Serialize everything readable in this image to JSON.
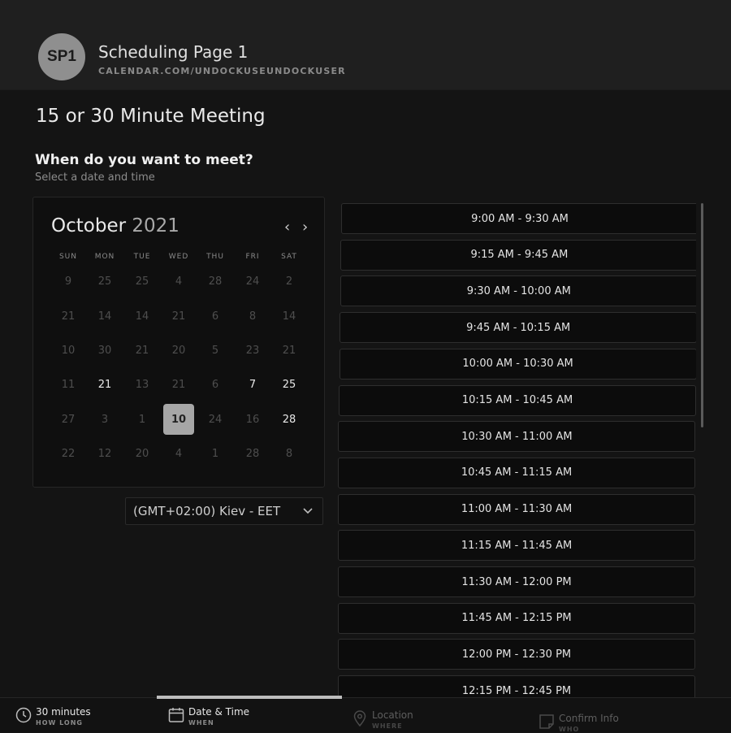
{
  "header": {
    "avatar_initials": "SP1",
    "title": "Scheduling Page 1",
    "url": "CALENDAR.COM/UNDOCKUSEUNDOCKUSER"
  },
  "meeting": {
    "title": "15 or 30 Minute Meeting",
    "question": "When do you want to meet?",
    "subtitle": "Select a date and time"
  },
  "calendar": {
    "month": "October",
    "year": "2021",
    "weekdays": [
      "SUN",
      "MON",
      "TUE",
      "WED",
      "THU",
      "FRI",
      "SAT"
    ],
    "weeks": [
      [
        {
          "d": "9"
        },
        {
          "d": "25"
        },
        {
          "d": "25"
        },
        {
          "d": "4"
        },
        {
          "d": "28"
        },
        {
          "d": "24"
        },
        {
          "d": "2"
        }
      ],
      [
        {
          "d": "21"
        },
        {
          "d": "14"
        },
        {
          "d": "14"
        },
        {
          "d": "21"
        },
        {
          "d": "6"
        },
        {
          "d": "8"
        },
        {
          "d": "14"
        }
      ],
      [
        {
          "d": "10"
        },
        {
          "d": "30"
        },
        {
          "d": "21"
        },
        {
          "d": "20"
        },
        {
          "d": "5"
        },
        {
          "d": "23"
        },
        {
          "d": "21"
        }
      ],
      [
        {
          "d": "11"
        },
        {
          "d": "21",
          "active": true
        },
        {
          "d": "13"
        },
        {
          "d": "21"
        },
        {
          "d": "6"
        },
        {
          "d": "7",
          "active": true
        },
        {
          "d": "25",
          "active": true
        }
      ],
      [
        {
          "d": "27"
        },
        {
          "d": "3"
        },
        {
          "d": "1"
        },
        {
          "d": "10",
          "selected": true
        },
        {
          "d": "24"
        },
        {
          "d": "16"
        },
        {
          "d": "28",
          "active": true
        }
      ],
      [
        {
          "d": "22"
        },
        {
          "d": "12"
        },
        {
          "d": "20"
        },
        {
          "d": "4"
        },
        {
          "d": "1"
        },
        {
          "d": "28"
        },
        {
          "d": "8"
        }
      ]
    ]
  },
  "timezone": {
    "value": "(GMT+02:00) Kiev - EET",
    "icon": "chevron-down-icon"
  },
  "time_slots": [
    "9:00 AM - 9:30 AM",
    "9:15 AM - 9:45 AM",
    "9:30 AM - 10:00 AM",
    "9:45 AM - 10:15 AM",
    "10:00 AM - 10:30 AM",
    "10:15 AM - 10:45 AM",
    "10:30 AM - 11:00 AM",
    "10:45 AM - 11:15 AM",
    "11:00 AM - 11:30 AM",
    "11:15 AM - 11:45 AM",
    "11:30 AM - 12:00 PM",
    "11:45 AM - 12:15 PM",
    "12:00 PM - 12:30 PM",
    "12:15 PM - 12:45 PM"
  ],
  "steps": [
    {
      "label": "30 minutes",
      "sub": "HOW LONG",
      "icon": "clock-icon",
      "state": "done"
    },
    {
      "label": "Date & Time",
      "sub": "WHEN",
      "icon": "calendar-icon",
      "state": "current"
    },
    {
      "label": "Location",
      "sub": "WHERE",
      "icon": "location-pin-icon",
      "state": "upcoming"
    },
    {
      "label": "Confirm Info",
      "sub": "WHO",
      "icon": "note-icon",
      "state": "upcoming"
    }
  ],
  "colors": {
    "background": "#141414",
    "header": "#1f1f1f",
    "selected_day": "#a6a6a6",
    "slot_border": "#2e2e2e"
  }
}
